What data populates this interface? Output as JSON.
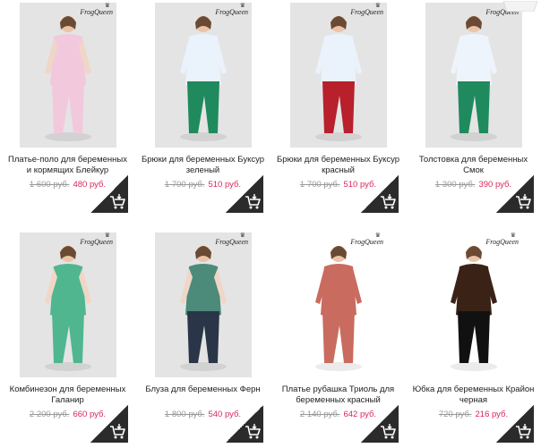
{
  "brand": "FrogQueen",
  "products": [
    {
      "name": "Платье-поло для беременных и кормящих Блейкур",
      "old_price": "1 600 руб.",
      "new_price": "480 руб.",
      "photo_bg": "#e4e4e4",
      "top": "#f2c9dc",
      "bottom": "#f2c9dc",
      "arms": "#f0d6c6"
    },
    {
      "name": "Брюки для беременных Буксур зеленый",
      "old_price": "1 700 руб.",
      "new_price": "510 руб.",
      "photo_bg": "#e4e4e4",
      "top": "#eaf2fb",
      "bottom": "#1f8a5e",
      "arms": "#eaf2fb"
    },
    {
      "name": "Брюки для беременных Буксур красный",
      "old_price": "1 700 руб.",
      "new_price": "510 руб.",
      "photo_bg": "#e4e4e4",
      "top": "#eaf2fb",
      "bottom": "#b8202b",
      "arms": "#eaf2fb"
    },
    {
      "name": "Толстовка для беременных Смок",
      "old_price": "1 300 руб.",
      "new_price": "390 руб.",
      "photo_bg": "#e4e4e4",
      "top": "#eef4fb",
      "bottom": "#1f8a5e",
      "arms": "#eef4fb"
    },
    {
      "name": "Комбинезон для беременных Галанир",
      "old_price": "2 200 руб.",
      "new_price": "660 руб.",
      "photo_bg": "#e4e4e4",
      "top": "#4fb690",
      "bottom": "#4fb690",
      "arms": "#f0d6c6"
    },
    {
      "name": "Блуза для беременных Ферн",
      "old_price": "1 800 руб.",
      "new_price": "540 руб.",
      "photo_bg": "#e4e4e4",
      "top": "#4c8a7a",
      "bottom": "#2a3548",
      "arms": "#f0d6c6"
    },
    {
      "name": "Платье рубашка Триоль для беременных красный",
      "old_price": "2 140 руб.",
      "new_price": "642 руб.",
      "photo_bg": "#ffffff",
      "top": "#c96b5f",
      "bottom": "#c96b5f",
      "arms": "#c96b5f"
    },
    {
      "name": "Юбка для беременных Крайон черная",
      "old_price": "720 руб.",
      "new_price": "216 руб.",
      "photo_bg": "#ffffff",
      "top": "#3b2216",
      "bottom": "#111111",
      "arms": "#3b2216"
    }
  ]
}
